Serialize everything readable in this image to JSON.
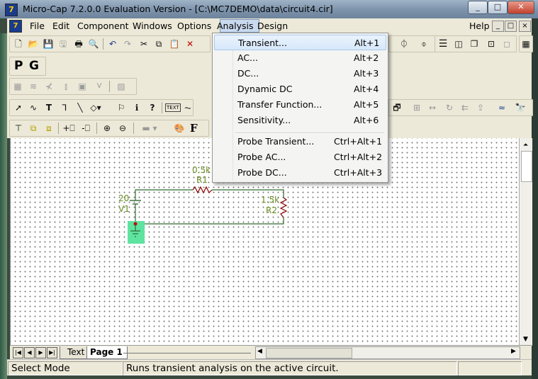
{
  "window": {
    "title": "Micro-Cap 7.2.0.0 Evaluation Version - [C:\\MC7DEMO\\data\\circuit4.cir]",
    "app_icon_glyph": "7",
    "caption_buttons": {
      "minimize": "_",
      "maximize": "□",
      "close": "✕"
    }
  },
  "menubar": {
    "items": [
      {
        "label": "File",
        "underline": "F"
      },
      {
        "label": "Edit",
        "underline": "E"
      },
      {
        "label": "Component",
        "underline": "C"
      },
      {
        "label": "Windows",
        "underline": "W"
      },
      {
        "label": "Options",
        "underline": "O"
      },
      {
        "label": "Analysis",
        "underline": "A",
        "active": true
      },
      {
        "label": "Design",
        "underline": "D"
      }
    ],
    "help": "Help",
    "mdi_buttons": {
      "minimize": "_",
      "restore": "□",
      "close": "×"
    }
  },
  "analysis_menu": {
    "items": [
      {
        "label": "Transient...",
        "accel": "Alt+1",
        "highlighted": true
      },
      {
        "label": "AC...",
        "accel": "Alt+2"
      },
      {
        "label": "DC...",
        "accel": "Alt+3"
      },
      {
        "label": "Dynamic DC",
        "accel": "Alt+4"
      },
      {
        "label": "Transfer Function...",
        "accel": "Alt+5"
      },
      {
        "label": "Sensitivity...",
        "accel": "Alt+6"
      },
      {
        "label": "Probe Transient...",
        "accel": "Ctrl+Alt+1"
      },
      {
        "label": "Probe AC...",
        "accel": "Ctrl+Alt+2"
      },
      {
        "label": "Probe DC...",
        "accel": "Ctrl+Alt+3"
      }
    ]
  },
  "toolbar": {
    "pg_labels": [
      "P",
      "G"
    ],
    "text_tool": "TEXT",
    "font_tool": "F"
  },
  "schematic": {
    "wire_color": "#2e6b2e",
    "component_color": "#2e6b2e",
    "label_color": "#6b8e23",
    "ground_highlight": "#5fe3a0",
    "components": [
      {
        "ref": "R1",
        "value": "0.5k",
        "type": "resistor"
      },
      {
        "ref": "R2",
        "value": "1.5k",
        "type": "resistor"
      },
      {
        "ref": "V1",
        "value": "20",
        "type": "battery"
      }
    ]
  },
  "tabs": {
    "items": [
      "Text",
      "Page 1"
    ],
    "active": "Page 1"
  },
  "status": {
    "mode": "Select Mode",
    "message": "Runs transient analysis on the active circuit."
  },
  "colors": {
    "menu_highlight": "#d7e8fb",
    "chrome": "#ece9d8",
    "titlebar": "#7f95ad"
  }
}
